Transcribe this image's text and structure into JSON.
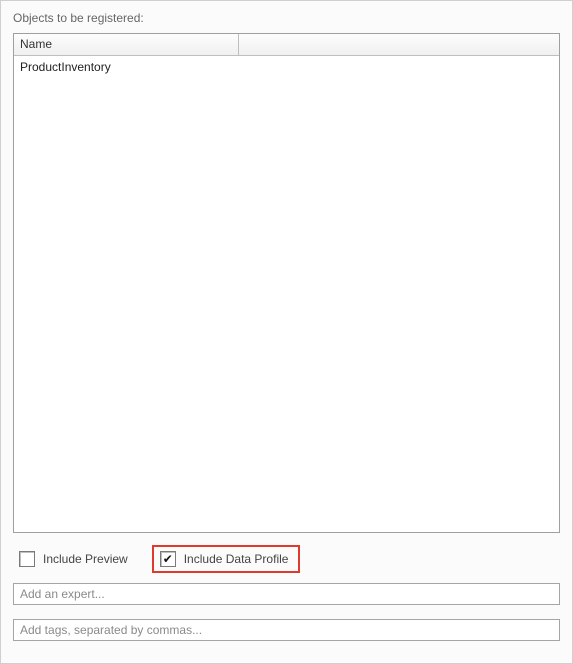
{
  "title": "Objects to be registered:",
  "table": {
    "columns": {
      "name": "Name"
    },
    "rows": [
      {
        "name": "ProductInventory"
      }
    ]
  },
  "options": {
    "include_preview": {
      "label": "Include Preview",
      "checked": false
    },
    "include_data_profile": {
      "label": "Include Data Profile",
      "checked": true
    }
  },
  "inputs": {
    "expert_placeholder": "Add an expert...",
    "tags_placeholder": "Add tags, separated by commas..."
  }
}
